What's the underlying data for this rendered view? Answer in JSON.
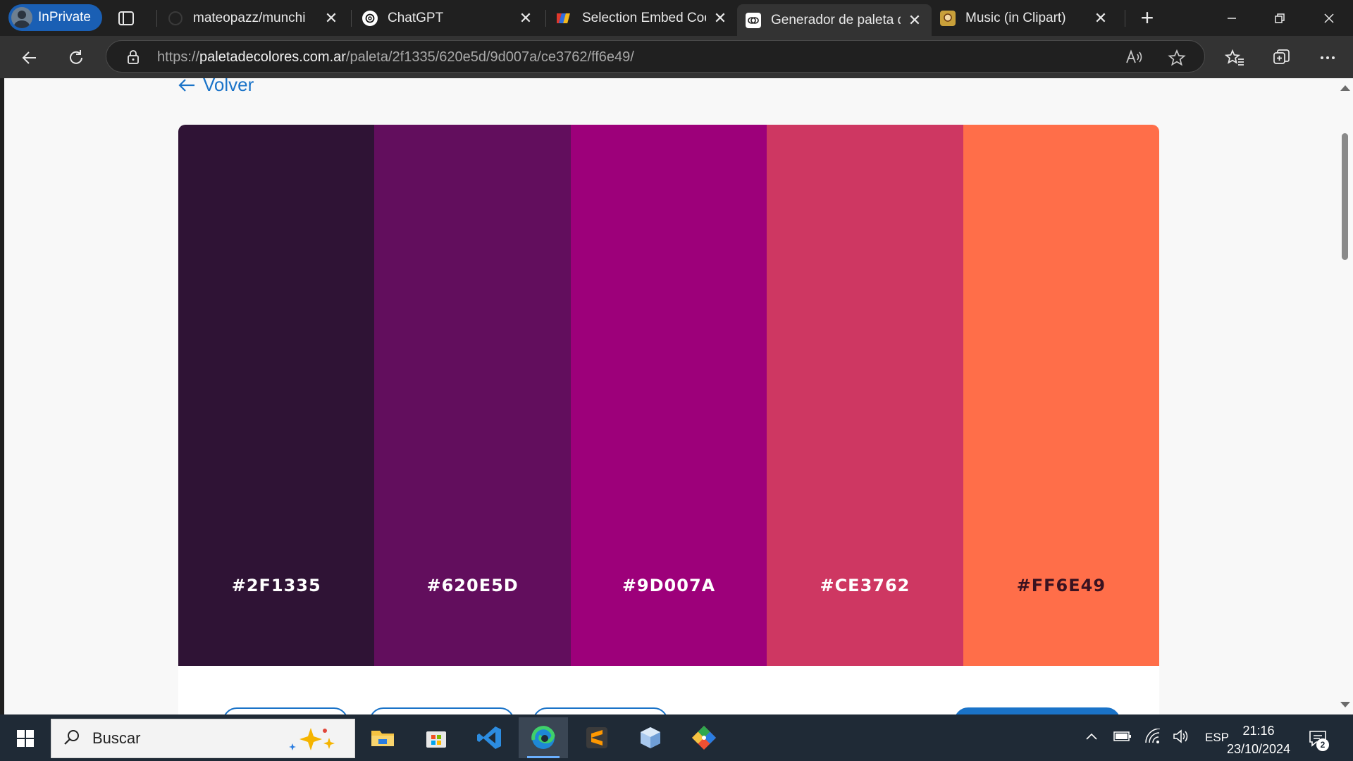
{
  "browser": {
    "inprivate_label": "InPrivate",
    "tabs": [
      {
        "title": "mateopazz/munchi",
        "icon": "github-icon"
      },
      {
        "title": "ChatGPT",
        "icon": "chatgpt-icon"
      },
      {
        "title": "Selection Embed Code",
        "icon": "embed-site-icon"
      },
      {
        "title": "Generador de paleta de colores",
        "icon": "palette-site-icon",
        "active": true
      },
      {
        "title": "Music (in Clipart)",
        "icon": "clipart-icon"
      }
    ],
    "url_prefix": "https://",
    "url_domain": "paletadecolores.com.ar",
    "url_path": "/paleta/2f1335/620e5d/9d007a/ce3762/ff6e49/"
  },
  "page": {
    "back_label": "Volver",
    "palette": [
      {
        "hex": "#2F1335",
        "color": "#2f1335"
      },
      {
        "hex": "#620E5D",
        "color": "#620e5d"
      },
      {
        "hex": "#9D007A",
        "color": "#9d007a"
      },
      {
        "hex": "#CE3762",
        "color": "#ce3762"
      },
      {
        "hex": "#FF6E49",
        "color": "#ff6e49"
      }
    ],
    "accent_color": "#1a73c8"
  },
  "taskbar": {
    "search_placeholder": "Buscar",
    "apps": [
      "file-explorer-icon",
      "microsoft-store-icon",
      "vscode-icon",
      "edge-icon",
      "sublime-text-icon",
      "virtualbox-icon",
      "git-icon"
    ],
    "language": "ESP",
    "time": "21:16",
    "date": "23/10/2024",
    "notification_count": "2"
  }
}
